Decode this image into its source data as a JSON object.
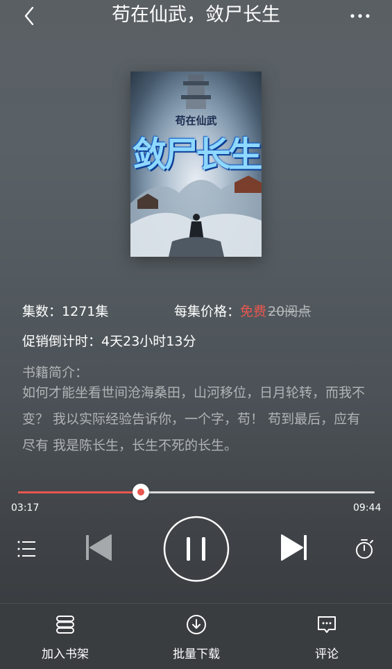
{
  "header": {
    "title": "苟在仙武，敛尸长生"
  },
  "cover": {
    "small_title": "苟在仙武",
    "big_title": "敛尸长生"
  },
  "info": {
    "episodes_label": "集数：",
    "episodes_value": "1271集",
    "price_label": "每集价格：",
    "price_free": "免费",
    "price_original": "20阅点",
    "countdown_label": "促销倒计时：",
    "countdown_value": "4天23小时13分"
  },
  "synopsis": {
    "label": "书籍简介：",
    "text": "如何才能坐看世间沧海桑田，山河移位，日月轮转，而我不变？ 我以实际经验告诉你，一个字，苟！ 苟到最后，应有尽有 我是陈长生，长生不死的长生。"
  },
  "player": {
    "current_time": "03:17",
    "total_time": "09:44",
    "progress_fraction": 0.345
  },
  "bottom_bar": {
    "items": [
      {
        "label": "加入书架",
        "icon": "bookshelf-icon"
      },
      {
        "label": "批量下载",
        "icon": "download-icon"
      },
      {
        "label": "评论",
        "icon": "comment-icon"
      }
    ]
  },
  "colors": {
    "accent": "#e8574f",
    "text_secondary": "#b1b4b7"
  }
}
